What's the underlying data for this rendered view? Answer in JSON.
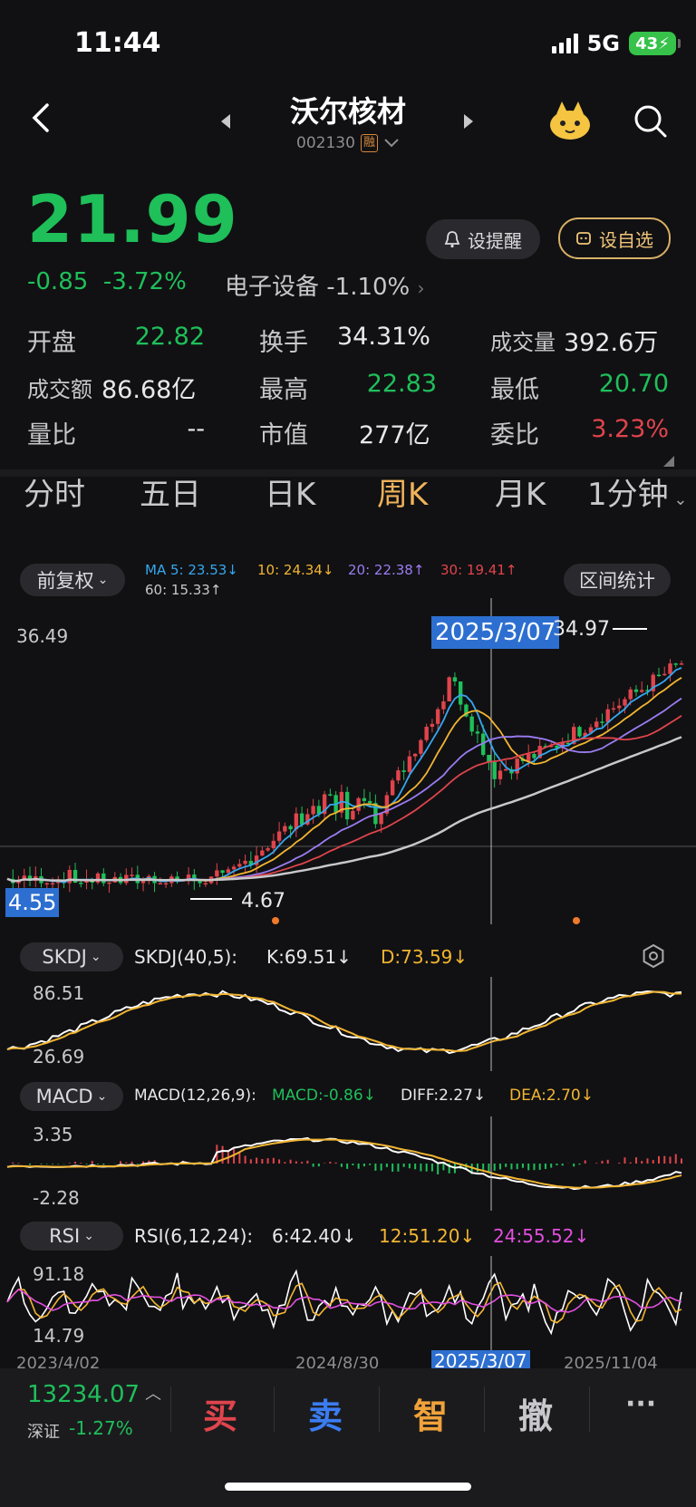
{
  "status": {
    "time": "11:44",
    "network": "5G",
    "battery": "43"
  },
  "header": {
    "title": "沃尔核材",
    "code": "002130",
    "badge": "融"
  },
  "actions": {
    "alert": "设提醒",
    "watch": "设自选"
  },
  "quote": {
    "price": "21.99",
    "change": "-0.85",
    "change_pct": "-3.72%",
    "sector": "电子设备",
    "sector_pct": "-1.10%",
    "stats": [
      {
        "label": "开盘",
        "value": "22.82"
      },
      {
        "label": "换手",
        "value": "34.31%"
      },
      {
        "label": "成交量",
        "value": "392.6万"
      },
      {
        "label": "成交额",
        "value": "86.68亿"
      },
      {
        "label": "最高",
        "value": "22.83"
      },
      {
        "label": "最低",
        "value": "20.70"
      },
      {
        "label": "量比",
        "value": "--"
      },
      {
        "label": "市值",
        "value": "277亿"
      },
      {
        "label": "委比",
        "value": "3.23%"
      }
    ]
  },
  "tabs": [
    "分时",
    "五日",
    "日K",
    "周K",
    "月K",
    "1分钟"
  ],
  "chart_toolbar": {
    "adjust": "前复权",
    "stats": "区间统计",
    "ma": [
      {
        "label": "MA 5: 23.53↓",
        "color": "#35a7f0"
      },
      {
        "label": "10: 24.34↓",
        "color": "#f2b531"
      },
      {
        "label": "20: 22.38↑",
        "color": "#9b7cf2"
      },
      {
        "label": "30: 19.41↑",
        "color": "#e0444c"
      },
      {
        "label": "60: 15.33↑",
        "color": "#c8c8cc"
      }
    ]
  },
  "main_chart": {
    "high_label": "36.49",
    "cursor_date": "2025/3/07",
    "peak": "34.97",
    "low_label": "4.67",
    "left_low": "4.55"
  },
  "skdj": {
    "name": "SKDJ",
    "title": "SKDJ(40,5):",
    "k": "K:69.51↓",
    "d": "D:73.59↓",
    "top": "86.51",
    "bottom": "26.69"
  },
  "macd": {
    "name": "MACD",
    "title": "MACD(12,26,9):",
    "macd": "MACD:-0.86↓",
    "diff": "DIFF:2.27↓",
    "dea": "DEA:2.70↓",
    "top": "3.35",
    "bottom": "-2.28"
  },
  "rsi": {
    "name": "RSI",
    "title": "RSI(6,12,24):",
    "r6": "6:42.40↓",
    "r12": "12:51.20↓",
    "r24": "24:55.52↓",
    "top": "91.18",
    "bottom": "14.79"
  },
  "x_dates": [
    "2023/4/02",
    "2024/8/30",
    "2025/3/07",
    "2025/11/04"
  ],
  "index": {
    "value": "13234.07",
    "name": "深证",
    "pct": "-1.27%"
  },
  "trade": {
    "buy": "买",
    "sell": "卖",
    "smart": "智",
    "cancel": "撤",
    "more": "···"
  },
  "colors": {
    "up": "#e0444c",
    "down": "#1fbf5a",
    "accent": "#f0b25a"
  }
}
